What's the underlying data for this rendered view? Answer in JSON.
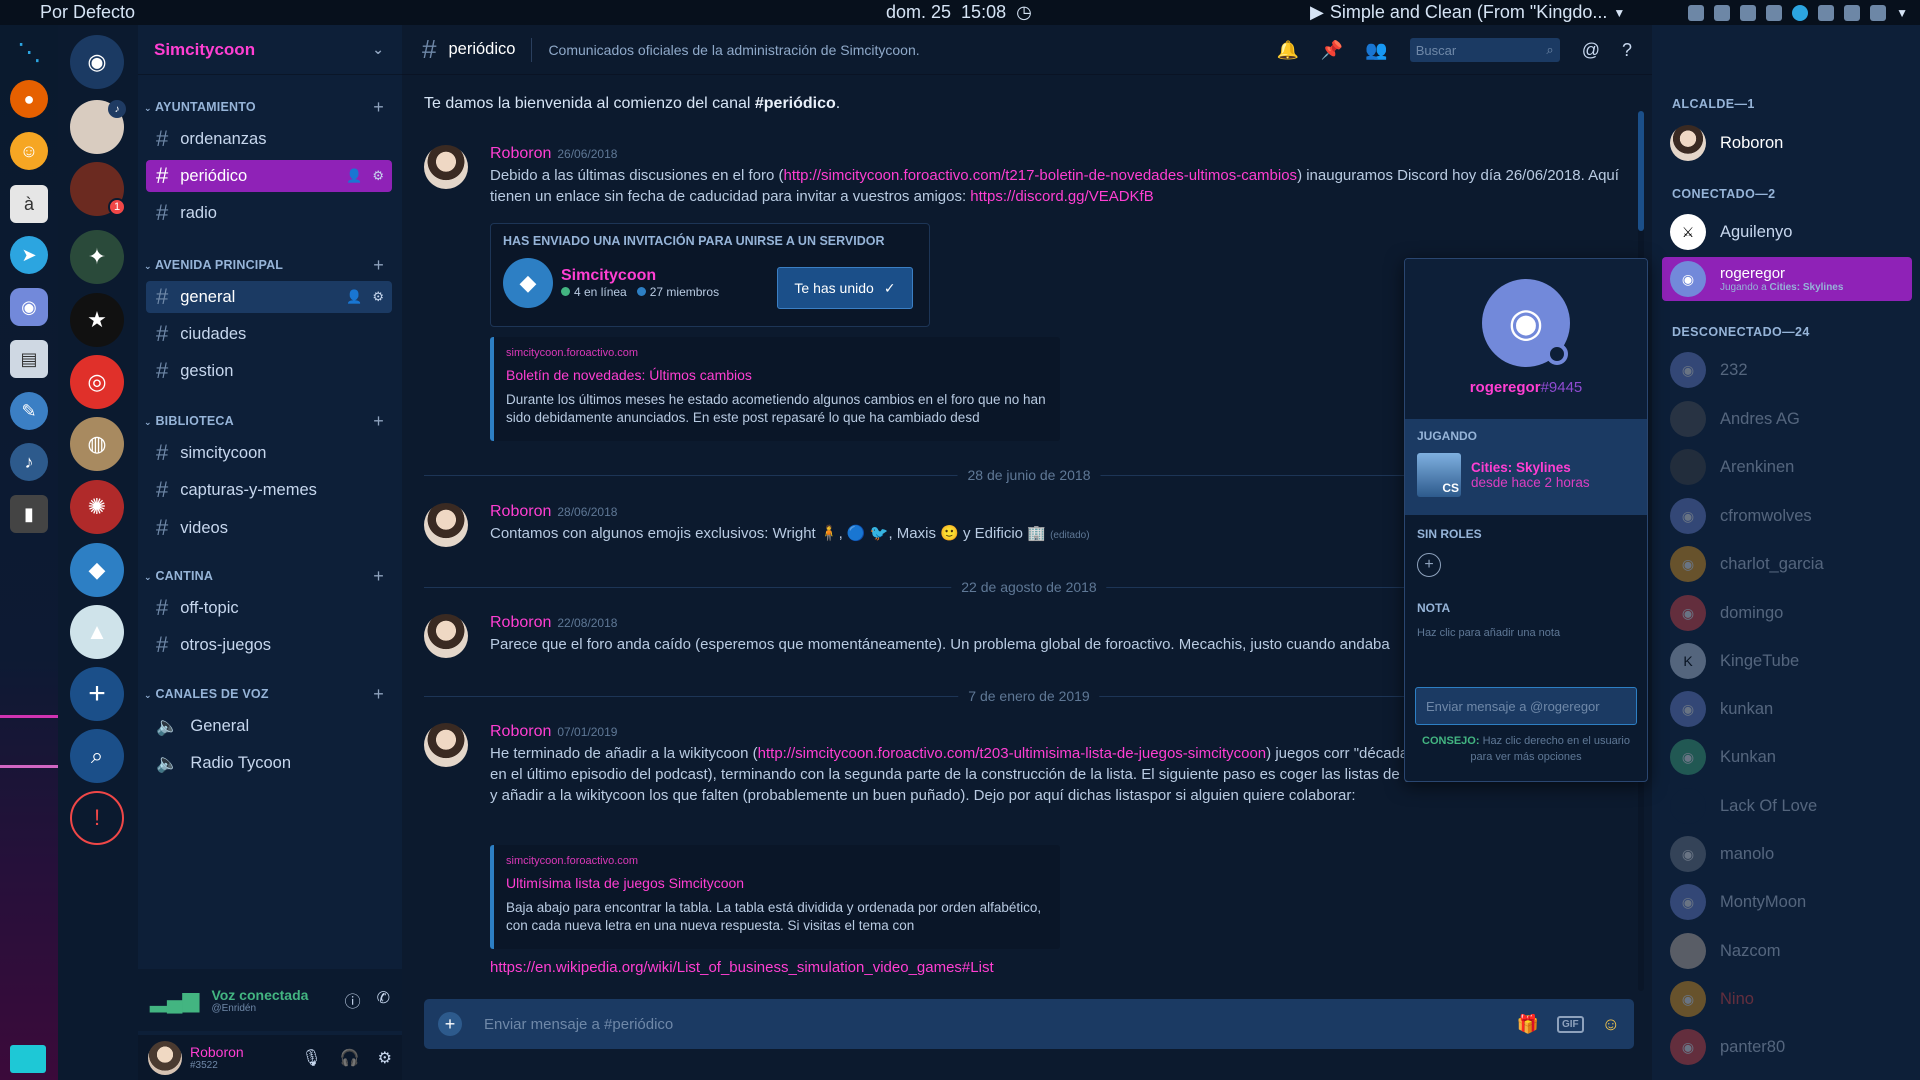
{
  "topbar": {
    "profile": "Por Defecto",
    "date": "dom. 25",
    "time": "15:08",
    "music": "Simple and Clean (From \"Kingdo..."
  },
  "guild": {
    "name": "Simcitycoon"
  },
  "categories": {
    "c1": "AYUNTAMIENTO",
    "c2": "AVENIDA PRINCIPAL",
    "c3": "BIBLIOTECA",
    "c4": "CANTINA",
    "c5": "CANALES DE VOZ"
  },
  "channels": {
    "ordenanzas": "ordenanzas",
    "periodico": "periódico",
    "radio": "radio",
    "general": "general",
    "ciudades": "ciudades",
    "gestion": "gestion",
    "simcitycoon": "simcitycoon",
    "capturas": "capturas-y-memes",
    "videos": "videos",
    "offtopic": "off-topic",
    "otros": "otros-juegos",
    "vgeneral": "General",
    "vradio": "Radio Tycoon"
  },
  "voice": {
    "title": "Voz conectada",
    "sub": "@Enridén"
  },
  "user": {
    "name": "Roboron",
    "tag": "#3522"
  },
  "header": {
    "channel": "periódico",
    "topic": "Comunicados oficiales de la administración de Simcitycoon.",
    "search_placeholder": "Buscar"
  },
  "chat": {
    "welcome_pre": "Te damos la bienvenida al comienzo del canal ",
    "welcome_chan": "#periódico",
    "welcome_post": ".",
    "m1": {
      "author": "Roboron",
      "time": "26/06/2018",
      "t1": "Debido a las últimas discusiones en el foro (",
      "link1": "http://simcitycoon.foroactivo.com/t217-boletin-de-novedades-ultimos-cambios",
      "t2": ") inauguramos Discord hoy día 26/06/2018. Aquí tienen un enlace sin fecha de caducidad para invitar a vuestros amigos: ",
      "link2": "https://discord.gg/VEADKfB"
    },
    "invite": {
      "heading": "HAS ENVIADO UNA INVITACIÓN PARA UNIRSE A UN SERVIDOR",
      "server": "Simcitycoon",
      "online": "4 en línea",
      "members": "27 miembros",
      "button": "Te has unido",
      "online_color": "#43b581",
      "members_color": "#2d7fc4"
    },
    "embed1": {
      "provider": "simcitycoon.foroactivo.com",
      "title": "Boletín de novedades: Últimos cambios",
      "desc": "Durante los últimos meses he estado acometiendo algunos cambios en el foro que no han sido debidamente anunciados. En este post repasaré lo que ha cambiado desd"
    },
    "sep1": "28 de junio de 2018",
    "m2": {
      "author": "Roboron",
      "time": "28/06/2018",
      "text": "Contamos con algunos emojis exclusivos: Wright",
      "maxis": ", Maxis",
      "edif": "y Edificio",
      "edited": "(editado)"
    },
    "sep2": "22 de agosto de 2018",
    "m3": {
      "author": "Roboron",
      "time": "22/08/2018",
      "text": "Parece que el foro anda caído (esperemos que momentáneamente). Un problema global de foroactivo. Mecachis, justo cuando andaba"
    },
    "sep3": "7 de enero de 2019",
    "m4": {
      "author": "Roboron",
      "time": "07/01/2019",
      "t1": "He terminado de añadir a la wikitycoon (",
      "link1": "http://simcitycoon.foroactivo.com/t203-ultimisima-lista-de-juegos-simcitycoon",
      "t2": ") juegos corr",
      "t3": "\"década oscura\" (tal como la llamamos en el último episodio del podcast), terminando con la segunda parte de la construcción de la lista. El siguiente paso es coger las listas de géneros que hay por la wikipedia y añadir a la wikitycoon los que falten (probablemente un buen puñado). Dejo por aquí dichas listaspor si alguien quiere colaborar:"
    },
    "embed2": {
      "provider": "simcitycoon.foroactivo.com",
      "title": "Ultimísima lista de juegos Simcitycoon",
      "desc": "Baja abajo para encontrar la tabla. La tabla está dividida y ordenada por orden alfabético, con cada nueva letra en una nueva respuesta. Si visitas el tema con"
    },
    "lastlink": "https://en.wikipedia.org/wiki/List_of_business_simulation_video_games#List",
    "composer_placeholder": "Enviar mensaje a #periódico",
    "gif": "GIF"
  },
  "members": {
    "cat1": "ALCALDE—1",
    "cat2": "CONECTADO—2",
    "cat3": "DESCONECTADO—24",
    "alcalde": [
      "Roboron"
    ],
    "online": [
      {
        "name": "Aguilenyo",
        "sub": ""
      },
      {
        "name": "rogeregor",
        "sub": "Jugando a ",
        "game": "Cities: Skylines"
      }
    ],
    "offline": [
      "232",
      "Andres AG",
      "Arenkinen",
      "cfromwolves",
      "charlot_garcia",
      "domingo",
      "KingeTube",
      "kunkan",
      "Kunkan",
      "Lack Of Love",
      "manolo",
      "MontyMoon",
      "Nazcom",
      "Nino",
      "panter80"
    ],
    "nino_color": "#f04747"
  },
  "popout": {
    "name": "rogeregor",
    "tag": "#9445",
    "playing_label": "JUGANDO",
    "game": "Cities: Skylines",
    "game_abbr": "CS",
    "since": "desde hace 2 horas",
    "roles_label": "SIN ROLES",
    "note_label": "NOTA",
    "note_placeholder": "Haz clic para añadir una nota",
    "dm_placeholder": "Enviar mensaje a @rogeregor",
    "tip_label": "CONSEJO:",
    "tip_text": "Haz clic derecho en el usuario para ver más opciones"
  }
}
